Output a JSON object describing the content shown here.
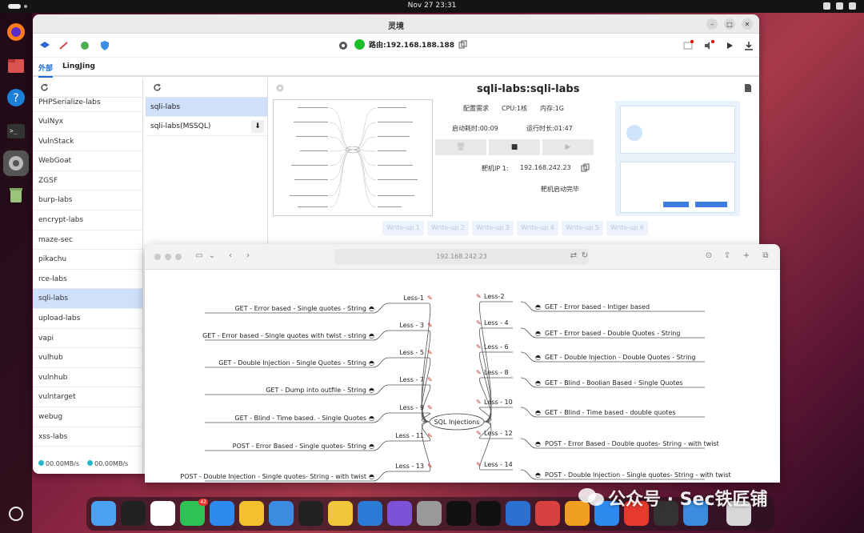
{
  "topbar": {
    "clock": "Nov 27  23:31"
  },
  "window": {
    "title": "灵境",
    "route_label": "路由:192.168.188.188",
    "tabs": [
      "外部",
      "LingJing"
    ]
  },
  "lab_list": {
    "items": [
      "PHPSerialize-labs",
      "VulNyx",
      "VulnStack",
      "WebGoat",
      "ZGSF",
      "burp-labs",
      "encrypt-labs",
      "maze-sec",
      "pikachu",
      "rce-labs",
      "sqli-labs",
      "upload-labs",
      "vapi",
      "vulhub",
      "vulnhub",
      "vulntarget",
      "webug",
      "xss-labs"
    ],
    "selected": "sqli-labs",
    "speed_down": "00.00MB/s",
    "speed_up": "00.00MB/s"
  },
  "image_list": {
    "items": [
      "sqli-labs",
      "sqli-labs(MSSQL)"
    ],
    "selected": "sqli-labs",
    "download_icon": "download-icon"
  },
  "detail": {
    "name": "sqli-labs:sqli-labs",
    "config_label": "配置需求",
    "cpu": "CPU:1核",
    "memory": "内存:1G",
    "startup_time": "启动耗时:00:09",
    "run_time": "运行时长:01:47",
    "target_ip_label": "靶机IP 1:",
    "target_ip": "192.168.242.23",
    "status": "靶机启动完毕",
    "writeups": [
      "Write-up 1",
      "Write-up 2",
      "Write-up 3",
      "Write-up 4",
      "Write-up 5",
      "Write-up 6"
    ]
  },
  "browser": {
    "url": "192.168.242.23"
  },
  "mindmap": {
    "center": "SQL Injections",
    "left": [
      {
        "less": "Less-1",
        "desc": "GET - Error based - Single quotes - String"
      },
      {
        "less": "Less - 3",
        "desc": "GET - Error based - Single quotes with twist - string"
      },
      {
        "less": "Less - 5",
        "desc": "GET - Double Injection - Single Quotes - String"
      },
      {
        "less": "Less - 7",
        "desc": "GET - Dump into outfile - String"
      },
      {
        "less": "Less - 9",
        "desc": "GET - Blind - Time based. -  Single Quotes"
      },
      {
        "less": "Less - 11",
        "desc": "POST - Error Based - Single quotes- String"
      },
      {
        "less": "Less - 13",
        "desc": "POST - Double Injection - Single quotes- String - with twist"
      }
    ],
    "right": [
      {
        "less": "Less-2",
        "desc": "GET - Error based - Intiger based"
      },
      {
        "less": "Less - 4",
        "desc": "GET - Error based - Double Quotes - String"
      },
      {
        "less": "Less - 6",
        "desc": "GET - Double Injection - Double Quotes - String"
      },
      {
        "less": "Less - 8",
        "desc": "GET - Blind - Boolian Based - Single Quotes"
      },
      {
        "less": "Less - 10",
        "desc": "GET - Blind - Time based - double quotes"
      },
      {
        "less": "Less - 12",
        "desc": "POST - Error Based - Double quotes- String - with twist"
      },
      {
        "less": "Less - 14",
        "desc": "POST - Double Injection - Single quotes- String - with twist"
      }
    ]
  },
  "watermark": "公众号 · Sec铁匠铺",
  "dock_badge": "42",
  "colors": {
    "accent": "#1e6bd8",
    "selected_row": "#cfe0fb",
    "online": "#1bbf2a"
  }
}
